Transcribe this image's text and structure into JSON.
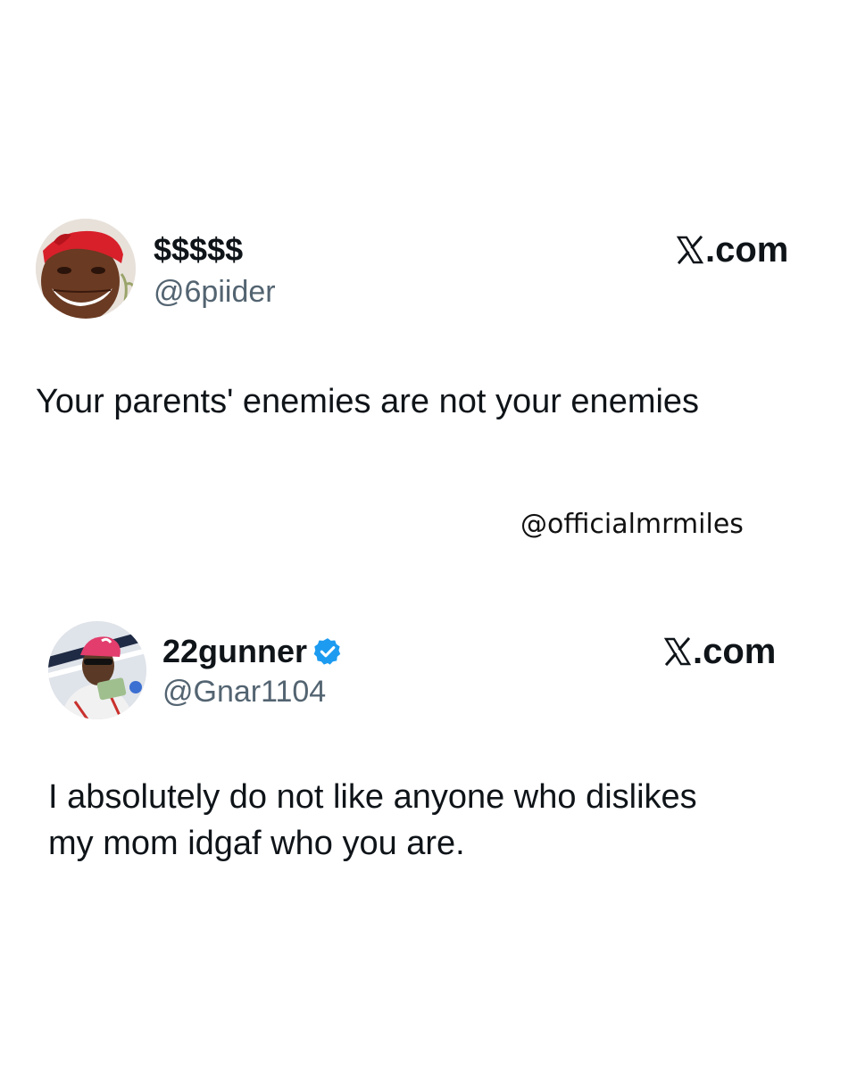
{
  "tweets": [
    {
      "display_name": "$$$$$",
      "handle": "@6piider",
      "verified": false,
      "brand": ".com",
      "brand_icon": "x-logo-icon",
      "text_lines": [
        "Your parents' enemies are not your enemies"
      ]
    },
    {
      "display_name": "22gunner",
      "handle": "@Gnar1104",
      "verified": true,
      "verified_color": "#1d9bf0",
      "brand": ".com",
      "brand_icon": "x-logo-icon",
      "text_lines": [
        "I absolutely do not like anyone who dislikes",
        "my mom idgaf who you are."
      ]
    }
  ],
  "watermark": "@officialmrmiles",
  "colors": {
    "text": "#0f1419",
    "handle": "#536471",
    "background": "#ffffff",
    "verified": "#1d9bf0"
  }
}
